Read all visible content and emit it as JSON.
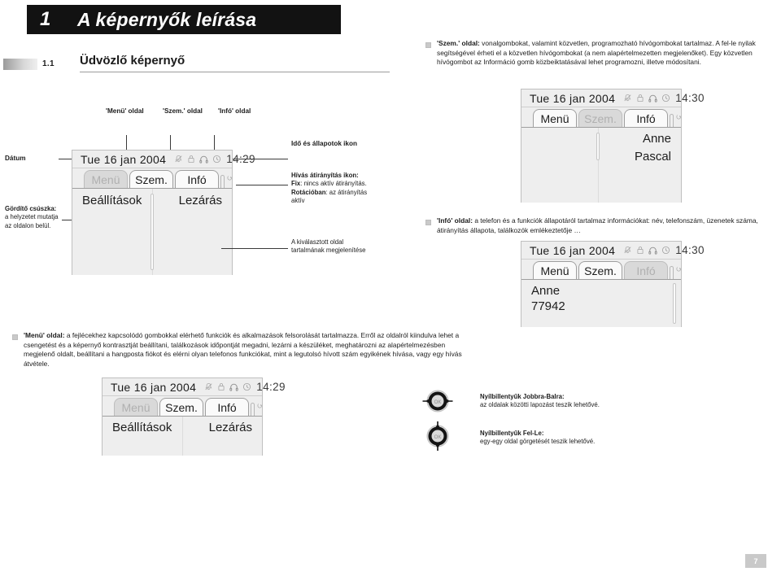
{
  "header": {
    "chapter_number": "1",
    "chapter_title": "A képernyők leírása"
  },
  "section": {
    "number": "1.1",
    "title": "Üdvözlő képernyő"
  },
  "intro_note": {
    "lead": "'Szem.' oldal:",
    "body": " vonalgombokat, valamint közvetlen, programozható hívógombokat tartalmaz. A fel-le nyilak segítségével érheti el a közvetlen hívógombokat (a nem alapértelmezetten megjelenőket). Egy közvetlen hívógombot az Információ gomb közbeiktatásával lehet programozni, illetve módosítani."
  },
  "column_labels": {
    "menu": "'Menü' oldal",
    "szem": "'Szem.' oldal",
    "info": "'Infó' oldal"
  },
  "left_labels": {
    "date": "Dátum",
    "scroll_head": "Gördítő csúszka:",
    "scroll_body_1": "a helyzetet mutatja",
    "scroll_body_2": "az oldalon belül."
  },
  "mid_labels": {
    "status_icon": "Idő és állapotok ikon",
    "forward_head": "Hívás átirányítás ikon:",
    "forward_fix_b": "Fix",
    "forward_fix_t": ": nincs aktív átirányítás.",
    "forward_rot_b": "Rotációban",
    "forward_rot_t": ": az átirányítás",
    "forward_rot_t2": "aktív",
    "selected_1": "A kiválasztott oldal",
    "selected_2": "tartalmának megjelenítése"
  },
  "info_note": {
    "lead": "'Infó' oldal:",
    "body": " a telefon és a funkciók állapotáról tartalmaz információkat: név, telefonszám, üzenetek száma, átirányítás állapota, találkozók emlékeztetője …"
  },
  "menu_note": {
    "lead": "'Menü' oldal:",
    "body": " a fejlécekhez kapcsolódó gombokkal elérhető funkciók és alkalmazások felsorolását tartalmazza. Erről az oldalról kiindulva lehet a csengetést és a képernyő kontrasztját beállítani, találkozások időpontját megadni, lezárni a készüléket, meghatározni az alapértelmezésben megjelenő oldalt, beállítani a hangposta fiókot és elérni olyan telefonos funkciókat, mint a legutolsó hívott szám egyikének hívása, vagy egy hívás átvétele."
  },
  "screens": {
    "main": {
      "date": "Tue 16 jan 2004",
      "time": "14:29",
      "tabs": [
        {
          "label": "Menü",
          "active": true
        },
        {
          "label": "Szem.",
          "active": false
        },
        {
          "label": "Infó",
          "active": false
        }
      ],
      "left_item": "Beállítások",
      "right_item": "Lezárás"
    },
    "szem": {
      "date": "Tue 16 jan 2004",
      "time": "14:30",
      "tabs": [
        {
          "label": "Menü",
          "active": false
        },
        {
          "label": "Szem.",
          "active": true
        },
        {
          "label": "Infó",
          "active": false
        }
      ],
      "right_items": [
        "Anne",
        "Pascal"
      ]
    },
    "info": {
      "date": "Tue 16 jan 2004",
      "time": "14:30",
      "tabs": [
        {
          "label": "Menü",
          "active": false
        },
        {
          "label": "Szem.",
          "active": false
        },
        {
          "label": "Infó",
          "active": true
        }
      ],
      "lines": [
        "Anne",
        "77942"
      ]
    },
    "bottom": {
      "date": "Tue 16 jan 2004",
      "time": "14:29",
      "tabs": [
        {
          "label": "Menü",
          "active": true
        },
        {
          "label": "Szem.",
          "active": false
        },
        {
          "label": "Infó",
          "active": false
        }
      ],
      "left_item": "Beállítások",
      "right_item": "Lezárás"
    }
  },
  "navkeys": [
    {
      "head": "Nyílbillentyűk Jobbra-Balra:",
      "body": "az oldalak közötti lapozást teszik lehetővé.",
      "center": "OK"
    },
    {
      "head": "Nyílbillentyűk Fel-Le:",
      "body": "egy-egy oldal görgetését teszik lehetővé.",
      "center": "OK"
    }
  ],
  "footer": {
    "page_number": "7"
  }
}
